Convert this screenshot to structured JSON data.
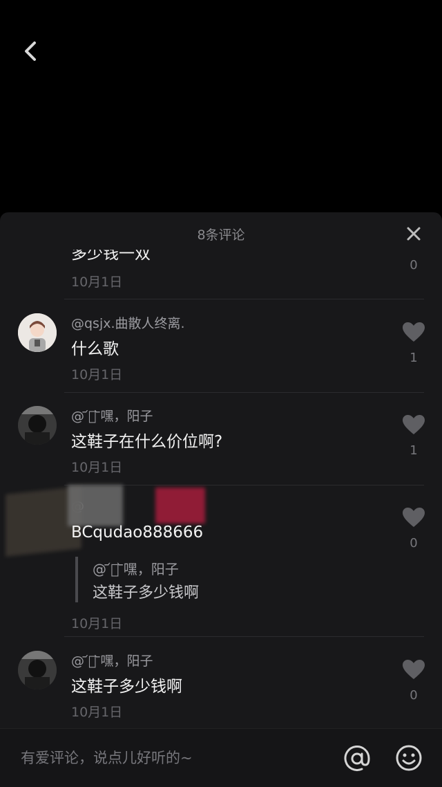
{
  "header": {
    "back_icon": "chevron-left-icon"
  },
  "sheet": {
    "title": "8条评论",
    "close_icon": "close-icon"
  },
  "comments": [
    {
      "username": "",
      "text": "多少钱一双",
      "date": "10月1日",
      "likes": "0"
    },
    {
      "username": "@qsjx.曲散人终离.",
      "text": "什么歌",
      "date": "10月1日",
      "likes": "1"
    },
    {
      "username": "@ ᷄ั ᷅嘿，阳子",
      "text": "这鞋子在什么价位啊?",
      "date": "10月1日",
      "likes": "1"
    },
    {
      "username": "@",
      "text": "BCqudao888666",
      "date": "10月1日",
      "likes": "0",
      "quote": {
        "username": "@ ᷄ั ᷅嘿，阳子",
        "text": "这鞋子多少钱啊"
      }
    },
    {
      "username": "@ ᷄ั ᷅嘿，阳子",
      "text": "这鞋子多少钱啊",
      "date": "10月1日",
      "likes": "0"
    }
  ],
  "input": {
    "placeholder": "有爱评论，说点儿好听的~",
    "at_icon": "at-icon",
    "emoji_icon": "emoji-icon"
  },
  "colors": {
    "background": "#000000",
    "sheet": "#18181a",
    "heart": "#5f5f63"
  }
}
